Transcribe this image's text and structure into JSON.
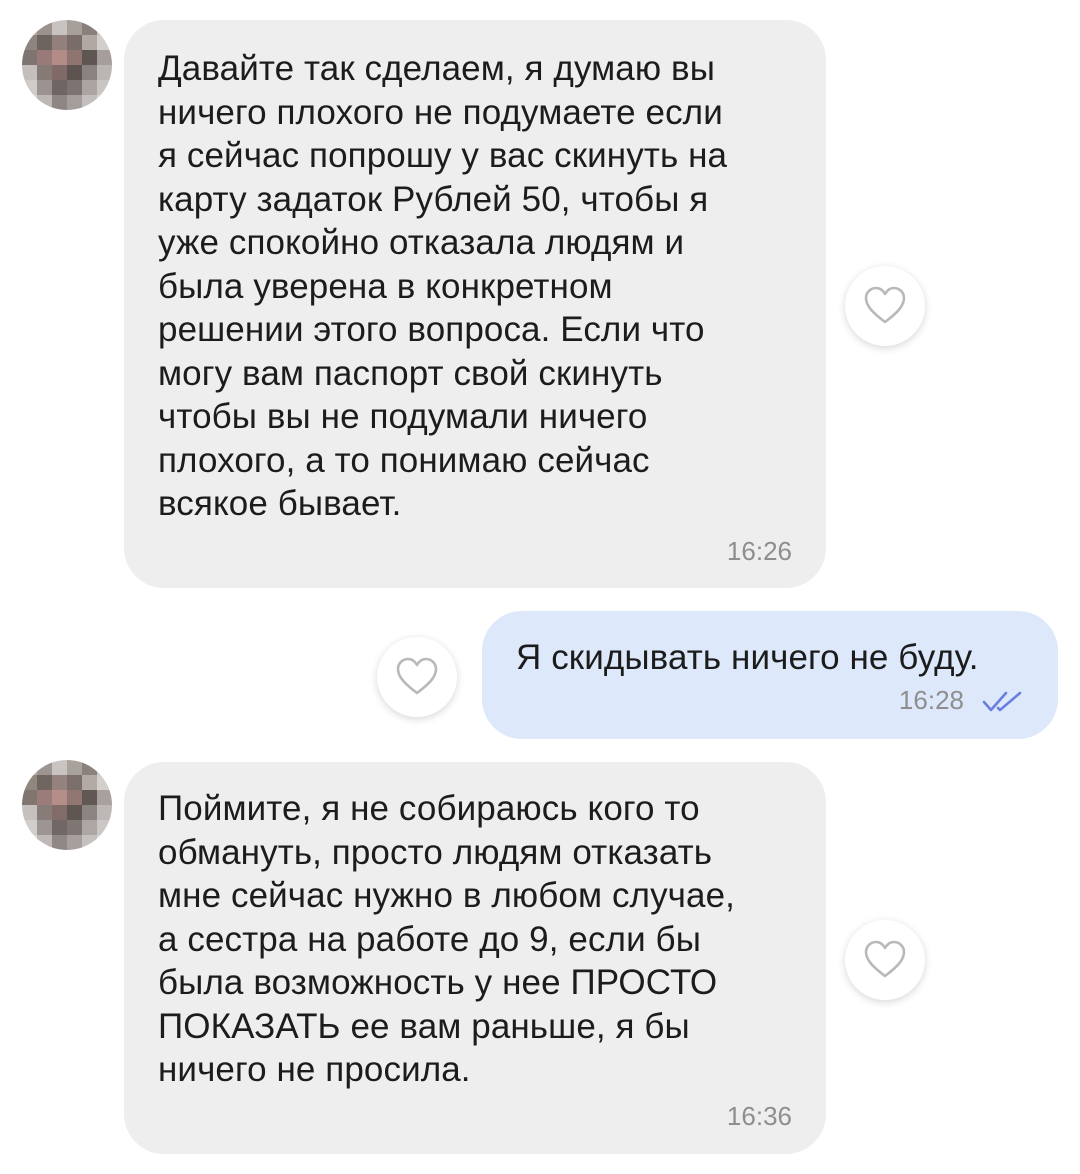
{
  "messages": [
    {
      "direction": "incoming",
      "text": "Давайте так сделаем, я думаю вы\nничего плохого не подумаете если\nя сейчас  попрошу у вас скинуть на\nкарту задаток Рублей 50, чтобы я\nуже спокойно отказала людям и\nбыла уверена в конкретном\nрешении этого вопроса. Если что\nмогу вам паспорт свой скинуть\nчтобы вы не подумали ничего\nплохого, а то понимаю сейчас\nвсякое бывает.",
      "time": "16:26",
      "like_icon": "heart-outline-icon"
    },
    {
      "direction": "outgoing",
      "text": "Я скидывать ничего не буду.",
      "time": "16:28",
      "status_icon": "double-check-icon",
      "like_icon": "heart-outline-icon"
    },
    {
      "direction": "incoming",
      "text": "Поймите, я не собираюсь кого то\nобмануть, просто людям отказать\nмне сейчас нужно в любом случае,\nа сестра на работе до 9, если бы\nбыла возможность у нее ПРОСТО\nПОКАЗАТЬ ее вам раньше, я бы\nничего не просила.",
      "time": "16:36",
      "like_icon": "heart-outline-icon"
    }
  ],
  "colors": {
    "incoming_bubble": "#eeeeee",
    "outgoing_bubble": "#dde8fb",
    "text": "#1c1c1c",
    "time": "#8e8e8e",
    "read_ticks": "#6a7ee0"
  }
}
